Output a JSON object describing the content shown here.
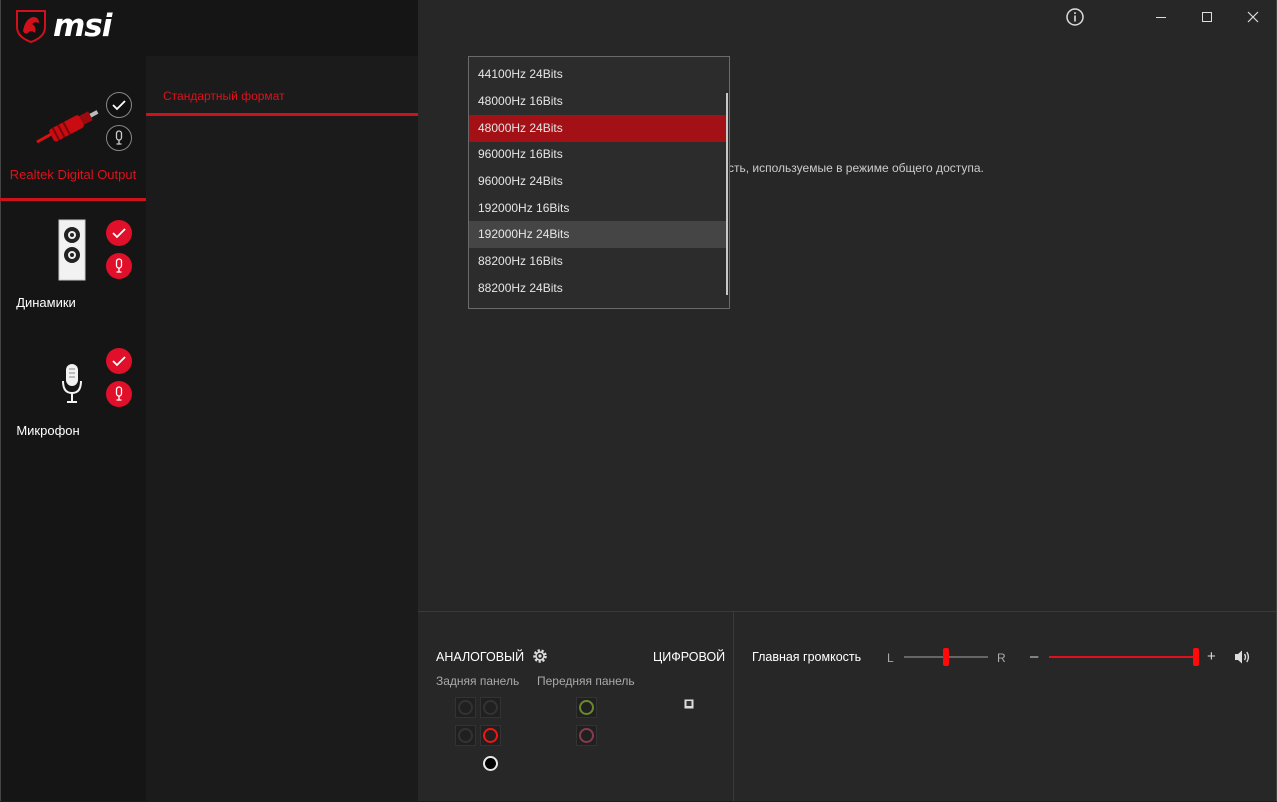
{
  "app": {
    "logo_text": "msi",
    "window_controls": {
      "info": "ⓘ",
      "minimize": "—",
      "maximize": "☐",
      "close": "✕"
    }
  },
  "devices": [
    {
      "label": "Realtek Digital Output",
      "icon": "digital-cable-icon",
      "active": true
    },
    {
      "label": "Динамики",
      "icon": "speaker-icon",
      "active": false
    },
    {
      "label": "Микрофон",
      "icon": "microphone-icon",
      "active": false
    }
  ],
  "middle": {
    "tab_label": "Стандартный формат"
  },
  "main": {
    "description_partial": "сть, используемые в режиме общего доступа."
  },
  "format_dropdown": {
    "options": [
      "44100Hz 24Bits",
      "48000Hz 16Bits",
      "48000Hz 24Bits",
      "96000Hz 16Bits",
      "96000Hz 24Bits",
      "192000Hz 16Bits",
      "192000Hz 24Bits",
      "88200Hz 16Bits",
      "88200Hz 24Bits"
    ],
    "selected": "48000Hz 24Bits",
    "hovered": "192000Hz 24Bits"
  },
  "bottom": {
    "analog_label": "АНАЛОГОВЫЙ",
    "digital_label": "ЦИФРОВОЙ",
    "rear_panel_label": "Задняя панель",
    "front_panel_label": "Передняя панель",
    "main_volume_label": "Главная громкость",
    "balance_left": "L",
    "balance_right": "R",
    "minus": "–",
    "plus": "+",
    "balance_value": 0.5,
    "volume_value": 1.0
  },
  "colors": {
    "accent_red": "#e0101c",
    "selected_row": "#a31116",
    "jack_green": "#6a8a2a",
    "jack_pink": "#8a3a4a"
  }
}
